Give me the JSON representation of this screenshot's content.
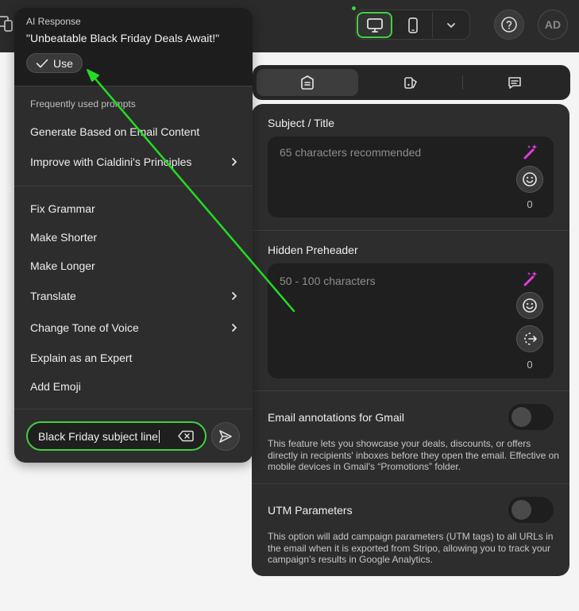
{
  "colors": {
    "accent": "#3fd13f",
    "wand": "#e63be0",
    "panel_bg": "#2d2d2d",
    "field_bg": "#1f1f1f"
  },
  "topbar": {
    "avatar_initials": "AD",
    "devices": [
      "desktop-icon",
      "mobile-icon",
      "chevron-down-icon"
    ],
    "selected_device": "desktop"
  },
  "tabs": [
    "settings-icon",
    "appearance-icon",
    "comments-icon"
  ],
  "settings": {
    "subject": {
      "label": "Subject / Title",
      "placeholder": "65 characters recommended",
      "count": "0"
    },
    "preheader": {
      "label": "Hidden Preheader",
      "placeholder": "50 - 100 characters",
      "count": "0"
    },
    "gmail": {
      "label": "Email annotations for Gmail",
      "enabled": false,
      "description": "This feature lets you showcase your deals, discounts, or offers directly in recipients' inboxes before they open the email. Effective on mobile devices in Gmail's “Promotions” folder."
    },
    "utm": {
      "label": "UTM Parameters",
      "enabled": false,
      "description": "This option will add campaign parameters (UTM tags) to all URLs in the email when it is exported from Stripo, allowing you to track your campaign’s results in Google Analytics."
    }
  },
  "ai_popover": {
    "response_label": "AI Response",
    "response_text": "\"Unbeatable Black Friday Deals Await!\"",
    "use_label": "Use",
    "frequent_header": "Frequently used prompts",
    "frequent": [
      {
        "label": "Generate Based on Email Content",
        "submenu": false
      },
      {
        "label": "Improve with Cialdini's Principles",
        "submenu": true
      }
    ],
    "actions": [
      {
        "label": "Fix Grammar",
        "submenu": false
      },
      {
        "label": "Make Shorter",
        "submenu": false
      },
      {
        "label": "Make Longer",
        "submenu": false
      },
      {
        "label": "Translate",
        "submenu": true
      },
      {
        "label": "Change Tone of Voice",
        "submenu": true
      },
      {
        "label": "Explain as an Expert",
        "submenu": false
      },
      {
        "label": "Add Emoji",
        "submenu": false
      }
    ],
    "prompt_value": "Black Friday subject line"
  }
}
